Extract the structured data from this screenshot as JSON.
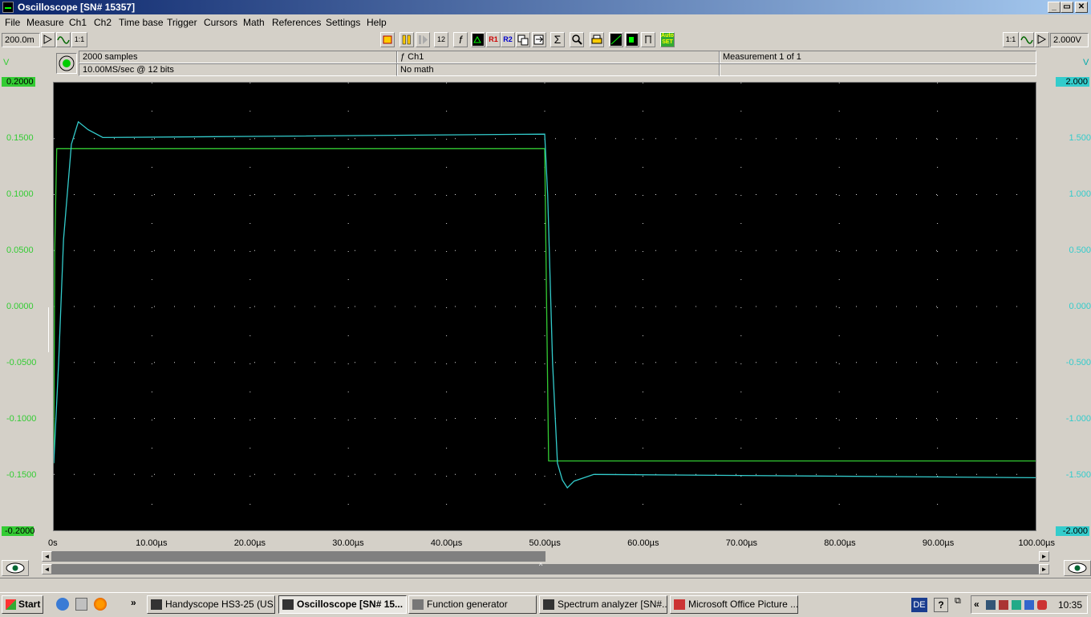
{
  "window": {
    "title": "Oscilloscope  [SN# 15357]",
    "minimize": "_",
    "restore": "▭",
    "close": "✕"
  },
  "menu": [
    "File",
    "Measure",
    "Ch1",
    "Ch2",
    "Time base",
    "Trigger",
    "Cursors",
    "Math",
    "References",
    "Settings",
    "Help"
  ],
  "toolbar": {
    "ch1_range": "200.0m",
    "ch2_range": "2.000V",
    "ratio_left": "1:1",
    "ratio_right": "1:1",
    "btn_12": "12",
    "btn_f": "f",
    "btn_r1": "R1",
    "btn_r2": "R2",
    "btn_sigma": "Σ",
    "btn_auto": "Auto SET",
    "colors": {
      "r1": "#cc0000",
      "r2": "#0000cc"
    }
  },
  "info": {
    "samples": "2000 samples",
    "rate": "10.00MS/sec @ 12 bits",
    "channel": "ƒ Ch1",
    "math": "No math",
    "measurement": "Measurement 1 of 1"
  },
  "axes": {
    "left_unit": "V",
    "right_unit": "V",
    "left_ticks": [
      "0.2000",
      "0.1500",
      "0.1000",
      "0.0500",
      "0.0000",
      "-0.0500",
      "-0.1000",
      "-0.1500",
      "-0.2000"
    ],
    "right_ticks": [
      "2.000",
      "1.500",
      "1.000",
      "0.500",
      "0.000",
      "-0.500",
      "-1.000",
      "-1.500",
      "-2.000"
    ],
    "x_ticks": [
      "0s",
      "10.00µs",
      "20.00µs",
      "30.00µs",
      "40.00µs",
      "50.00µs",
      "60.00µs",
      "70.00µs",
      "80.00µs",
      "90.00µs",
      "100.00µs"
    ]
  },
  "chart_data": {
    "type": "line",
    "xlim": [
      0,
      100
    ],
    "x_unit": "µs",
    "series": [
      {
        "name": "Ch1",
        "color": "#33cc33",
        "axis": "left",
        "ylim": [
          -0.2,
          0.2
        ],
        "points": [
          [
            0,
            -0.14
          ],
          [
            0.1,
            0.05
          ],
          [
            0.3,
            0.141
          ],
          [
            50,
            0.141
          ],
          [
            50.2,
            0.0
          ],
          [
            50.4,
            -0.138
          ],
          [
            100,
            -0.138
          ]
        ]
      },
      {
        "name": "Ch2",
        "color": "#33cccc",
        "axis": "right",
        "ylim": [
          -2.0,
          2.0
        ],
        "points": [
          [
            0,
            -1.4
          ],
          [
            0.5,
            -0.5
          ],
          [
            1,
            0.6
          ],
          [
            1.8,
            1.45
          ],
          [
            2.5,
            1.65
          ],
          [
            3.5,
            1.58
          ],
          [
            5,
            1.51
          ],
          [
            20,
            1.52
          ],
          [
            50,
            1.54
          ],
          [
            50.3,
            1.0
          ],
          [
            50.8,
            -0.5
          ],
          [
            51.3,
            -1.4
          ],
          [
            51.8,
            -1.55
          ],
          [
            52.3,
            -1.62
          ],
          [
            53,
            -1.56
          ],
          [
            55,
            -1.5
          ],
          [
            70,
            -1.51
          ],
          [
            100,
            -1.53
          ]
        ]
      }
    ]
  },
  "taskbar": {
    "start": "Start",
    "tasks": [
      "Handyscope HS3-25 (US...",
      "Oscilloscope  [SN# 15...",
      "Function generator",
      "Spectrum analyzer  [SN#...",
      "Microsoft Office Picture ..."
    ],
    "lang": "DE",
    "clock": "10:35",
    "chevrons": "»",
    "tray_chevron": "«"
  }
}
